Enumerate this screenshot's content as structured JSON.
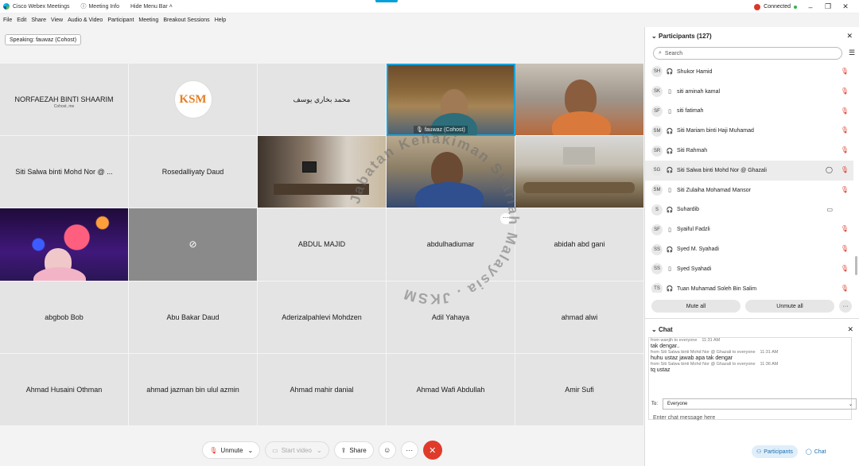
{
  "titlebar": {
    "app_name": "Cisco Webex Meetings",
    "meeting_info": "Meeting Info",
    "hide_menu": "Hide Menu Bar",
    "status": "Connected"
  },
  "menu": [
    "File",
    "Edit",
    "Share",
    "View",
    "Audio & Video",
    "Participant",
    "Meeting",
    "Breakout Sessions",
    "Help"
  ],
  "speaking": "Speaking: fauwaz (Cohost)",
  "tiles": {
    "t1_name": "NORFAEZAH BINTI SHAARIM",
    "t1_sub": "Cohost, me",
    "t3_name": "محمد بخاري يوسف",
    "t4_label": "fauwaz  (Cohost)",
    "t6_name": "Siti Salwa binti Mohd Nor @ ...",
    "t7_name": "Rosedalliyaty Daud",
    "t13_name": "ABDUL MAJID",
    "t14_name": "abdulhadiumar",
    "t15_name": "abidah abd gani",
    "t16_name": "abgbob Bob",
    "t17_name": "Abu Bakar Daud",
    "t18_name": "Aderizalpahlevi Mohdzen",
    "t19_name": "Adil Yahaya",
    "t20_name": "ahmad alwi",
    "t21_name": "Ahmad Husaini Othman",
    "t22_name": "ahmad jazman bin ulul azmin",
    "t23_name": "Ahmad mahir danial",
    "t24_name": "Ahmad Wafi Abdullah",
    "t25_name": "Amir Sufi",
    "logo_text": "KSM"
  },
  "watermark": "Jabatan Kehakiman Syariah Malaysia . JKSM",
  "toolbar": {
    "unmute": "Unmute",
    "start_video": "Start video",
    "share": "Share"
  },
  "participants": {
    "title": "Participants (127)",
    "search_placeholder": "Search",
    "mute_all": "Mute all",
    "unmute_all": "Unmute all",
    "list": [
      {
        "initials": "SH",
        "name": "Shukor Hamid"
      },
      {
        "initials": "SK",
        "name": "siti aminah kamal"
      },
      {
        "initials": "SF",
        "name": "siti fatimah"
      },
      {
        "initials": "SM",
        "name": "Siti Mariam binti Haji Muhamad"
      },
      {
        "initials": "SR",
        "name": "Siti Rahmah"
      },
      {
        "initials": "SG",
        "name": "Siti Salwa binti Mohd Nor @ Ghazali"
      },
      {
        "initials": "SM",
        "name": "Siti Zulaiha Mohamad Mansor"
      },
      {
        "initials": "S",
        "name": "Suhardib"
      },
      {
        "initials": "SF",
        "name": "Syaiful Fadzli"
      },
      {
        "initials": "SS",
        "name": "Syed M. Syahadi"
      },
      {
        "initials": "SS",
        "name": "Syed Syahadi"
      },
      {
        "initials": "TS",
        "name": "Tuan Muhamad Soleh Bin Salim"
      }
    ]
  },
  "chat": {
    "title": "Chat",
    "messages": [
      {
        "meta": "from wanjih to everyone",
        "time": "11:31 AM",
        "text": "tak dengar.."
      },
      {
        "meta": "from Siti Salwa binti Mohd Nor @ Ghazali to everyone",
        "time": "11:31 AM",
        "text": "huhu ustaz jawab apa tak dengar"
      },
      {
        "meta": "from Siti Salwa binti Mohd Nor @ Ghazali to everyone",
        "time": "11:36 AM",
        "text": "tq ustaz"
      }
    ],
    "to_label": "To:",
    "to_value": "Everyone",
    "input_placeholder": "Enter chat message here"
  },
  "panel_tabs": {
    "participants": "Participants",
    "chat": "Chat"
  },
  "colors": {
    "accent": "#049fd9",
    "end_call": "#e03a2b",
    "tile_bg": "#e4e4e4"
  }
}
